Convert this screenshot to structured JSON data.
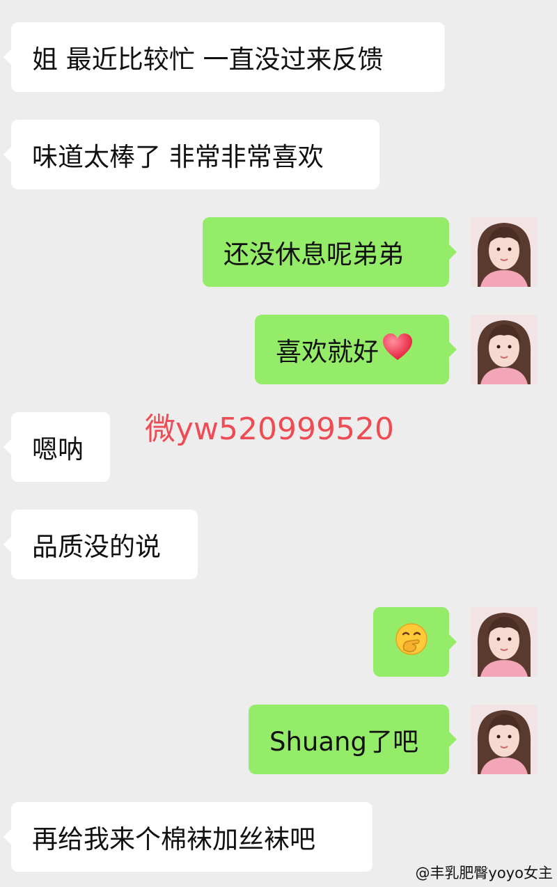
{
  "messages": [
    {
      "side": "in",
      "text": "姐 最近比较忙 一直没过来反馈"
    },
    {
      "side": "in",
      "text": "味道太棒了 非常非常喜欢"
    },
    {
      "side": "out",
      "text": "还没休息呢弟弟"
    },
    {
      "side": "out",
      "text": "喜欢就好",
      "emoji": "red-heart-icon"
    },
    {
      "side": "in",
      "text": "嗯呐"
    },
    {
      "side": "in",
      "text": "品质没的说"
    },
    {
      "side": "out",
      "text": "",
      "emoji": "hand-over-mouth-face-icon"
    },
    {
      "side": "out",
      "text": "Shuang了吧"
    },
    {
      "side": "in",
      "text": "再给我来个棉袜加丝袜吧"
    }
  ],
  "watermark": "微yw520999520",
  "credit": "@丰乳肥臀yoyo女主",
  "colors": {
    "background": "#ededed",
    "incoming_bubble": "#ffffff",
    "outgoing_bubble": "#95ec69",
    "watermark": "#ee4c54"
  }
}
